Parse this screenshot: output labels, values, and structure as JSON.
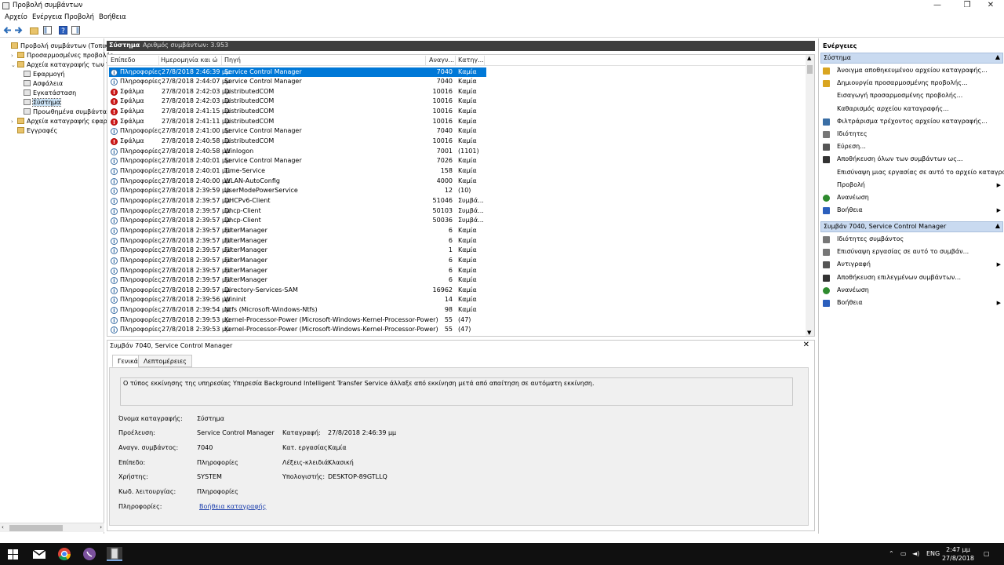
{
  "window": {
    "title": "Προβολή συμβάντων",
    "min": "—",
    "max": "❐",
    "close": "✕"
  },
  "menu": [
    "Αρχείο",
    "Ενέργεια",
    "Προβολή",
    "Βοήθεια"
  ],
  "tree": {
    "items": [
      {
        "label": "Προβολή συμβάντων (Τοπική)",
        "indent": 0,
        "expander": ""
      },
      {
        "label": "Προσαρμοσμένες προβολές",
        "indent": 1,
        "expander": "›"
      },
      {
        "label": "Αρχεία καταγραφής των Wi",
        "indent": 1,
        "expander": "⌄"
      },
      {
        "label": "Εφαρμογή",
        "indent": 2,
        "expander": ""
      },
      {
        "label": "Ασφάλεια",
        "indent": 2,
        "expander": ""
      },
      {
        "label": "Εγκατάσταση",
        "indent": 2,
        "expander": ""
      },
      {
        "label": "Σύστημα",
        "indent": 2,
        "expander": "",
        "selected": true
      },
      {
        "label": "Προωθημένα συμβάντα",
        "indent": 2,
        "expander": ""
      },
      {
        "label": "Αρχεία καταγραφής εφαρμ",
        "indent": 1,
        "expander": "›"
      },
      {
        "label": "Εγγραφές",
        "indent": 1,
        "expander": ""
      }
    ]
  },
  "center": {
    "log_name": "Σύστημα",
    "count_text": "Αριθμός συμβάντων: 3.953"
  },
  "grid": {
    "columns": [
      "Επίπεδο",
      "Ημερομηνία και ώ",
      "Πηγή",
      "Αναγν...",
      "Κατηγ..."
    ],
    "rows": [
      {
        "level": "Πληροφορίες",
        "type": "info",
        "date": "27/8/2018 2:46:39 μμ",
        "source": "Service Control Manager",
        "id": "7040",
        "cat": "Καμία",
        "selected": true
      },
      {
        "level": "Πληροφορίες",
        "type": "info",
        "date": "27/8/2018 2:44:07 μμ",
        "source": "Service Control Manager",
        "id": "7040",
        "cat": "Καμία"
      },
      {
        "level": "Σφάλμα",
        "type": "err",
        "date": "27/8/2018 2:42:03 μμ",
        "source": "DistributedCOM",
        "id": "10016",
        "cat": "Καμία"
      },
      {
        "level": "Σφάλμα",
        "type": "err",
        "date": "27/8/2018 2:42:03 μμ",
        "source": "DistributedCOM",
        "id": "10016",
        "cat": "Καμία"
      },
      {
        "level": "Σφάλμα",
        "type": "err",
        "date": "27/8/2018 2:41:15 μμ",
        "source": "DistributedCOM",
        "id": "10016",
        "cat": "Καμία"
      },
      {
        "level": "Σφάλμα",
        "type": "err",
        "date": "27/8/2018 2:41:11 μμ",
        "source": "DistributedCOM",
        "id": "10016",
        "cat": "Καμία"
      },
      {
        "level": "Πληροφορίες",
        "type": "info",
        "date": "27/8/2018 2:41:00 μμ",
        "source": "Service Control Manager",
        "id": "7040",
        "cat": "Καμία"
      },
      {
        "level": "Σφάλμα",
        "type": "err",
        "date": "27/8/2018 2:40:58 μμ",
        "source": "DistributedCOM",
        "id": "10016",
        "cat": "Καμία"
      },
      {
        "level": "Πληροφορίες",
        "type": "info",
        "date": "27/8/2018 2:40:58 μμ",
        "source": "Winlogon",
        "id": "7001",
        "cat": "(1101)"
      },
      {
        "level": "Πληροφορίες",
        "type": "info",
        "date": "27/8/2018 2:40:01 μμ",
        "source": "Service Control Manager",
        "id": "7026",
        "cat": "Καμία"
      },
      {
        "level": "Πληροφορίες",
        "type": "info",
        "date": "27/8/2018 2:40:01 μμ",
        "source": "Time-Service",
        "id": "158",
        "cat": "Καμία"
      },
      {
        "level": "Πληροφορίες",
        "type": "info",
        "date": "27/8/2018 2:40:00 μμ",
        "source": "WLAN-AutoConfig",
        "id": "4000",
        "cat": "Καμία"
      },
      {
        "level": "Πληροφορίες",
        "type": "info",
        "date": "27/8/2018 2:39:59 μμ",
        "source": "UserModePowerService",
        "id": "12",
        "cat": "(10)"
      },
      {
        "level": "Πληροφορίες",
        "type": "info",
        "date": "27/8/2018 2:39:57 μμ",
        "source": "DHCPv6-Client",
        "id": "51046",
        "cat": "Συμβά..."
      },
      {
        "level": "Πληροφορίες",
        "type": "info",
        "date": "27/8/2018 2:39:57 μμ",
        "source": "Dhcp-Client",
        "id": "50103",
        "cat": "Συμβά..."
      },
      {
        "level": "Πληροφορίες",
        "type": "info",
        "date": "27/8/2018 2:39:57 μμ",
        "source": "Dhcp-Client",
        "id": "50036",
        "cat": "Συμβά..."
      },
      {
        "level": "Πληροφορίες",
        "type": "info",
        "date": "27/8/2018 2:39:57 μμ",
        "source": "FilterManager",
        "id": "6",
        "cat": "Καμία"
      },
      {
        "level": "Πληροφορίες",
        "type": "info",
        "date": "27/8/2018 2:39:57 μμ",
        "source": "FilterManager",
        "id": "6",
        "cat": "Καμία"
      },
      {
        "level": "Πληροφορίες",
        "type": "info",
        "date": "27/8/2018 2:39:57 μμ",
        "source": "FilterManager",
        "id": "1",
        "cat": "Καμία"
      },
      {
        "level": "Πληροφορίες",
        "type": "info",
        "date": "27/8/2018 2:39:57 μμ",
        "source": "FilterManager",
        "id": "6",
        "cat": "Καμία"
      },
      {
        "level": "Πληροφορίες",
        "type": "info",
        "date": "27/8/2018 2:39:57 μμ",
        "source": "FilterManager",
        "id": "6",
        "cat": "Καμία"
      },
      {
        "level": "Πληροφορίες",
        "type": "info",
        "date": "27/8/2018 2:39:57 μμ",
        "source": "FilterManager",
        "id": "6",
        "cat": "Καμία"
      },
      {
        "level": "Πληροφορίες",
        "type": "info",
        "date": "27/8/2018 2:39:57 μμ",
        "source": "Directory-Services-SAM",
        "id": "16962",
        "cat": "Καμία"
      },
      {
        "level": "Πληροφορίες",
        "type": "info",
        "date": "27/8/2018 2:39:56 μμ",
        "source": "Wininit",
        "id": "14",
        "cat": "Καμία"
      },
      {
        "level": "Πληροφορίες",
        "type": "info",
        "date": "27/8/2018 2:39:54 μμ",
        "source": "Ntfs (Microsoft-Windows-Ntfs)",
        "id": "98",
        "cat": "Καμία"
      },
      {
        "level": "Πληροφορίες",
        "type": "info",
        "date": "27/8/2018 2:39:53 μμ",
        "source": "Kernel-Processor-Power (Microsoft-Windows-Kernel-Processor-Power)",
        "id": "55",
        "cat": "(47)"
      },
      {
        "level": "Πληροφορίες",
        "type": "info",
        "date": "27/8/2018 2:39:53 μμ",
        "source": "Kernel-Processor-Power (Microsoft-Windows-Kernel-Processor-Power)",
        "id": "55",
        "cat": "(47)"
      }
    ]
  },
  "details": {
    "title": "Συμβάν 7040, Service Control Manager",
    "close": "✕",
    "tab_general": "Γενικά",
    "tab_details": "Λεπτομέρειες",
    "message": "Ο τύπος εκκίνησης της υπηρεσίας Υπηρεσία Background Intelligent Transfer Service άλλαξε από εκκίνηση μετά από απαίτηση σε αυτόματη εκκίνηση.",
    "log_name_label": "Όνομα καταγραφής:",
    "log_name": "Σύστημα",
    "source_label": "Προέλευση:",
    "source": "Service Control Manager",
    "logged_label": "Καταγραφή:",
    "logged": "27/8/2018 2:46:39 μμ",
    "event_id_label": "Αναγν. συμβάντος:",
    "event_id": "7040",
    "task_label": "Κατ. εργασίας:",
    "task": "Καμία",
    "level_label": "Επίπεδο:",
    "level": "Πληροφορίες",
    "keywords_label": "Λέξεις-κλειδιά:",
    "keywords": "Κλασική",
    "user_label": "Χρήστης:",
    "user": "SYSTEM",
    "computer_label": "Υπολογιστής:",
    "computer": "DESKTOP-89GTLLQ",
    "opcode_label": "Κωδ. λειτουργίας:",
    "opcode": "Πληροφορίες",
    "info_label": "Πληροφορίες:",
    "info_link": "Βοήθεια καταγραφής"
  },
  "actions": {
    "title": "Ενέργειες",
    "section1": "Σύστημα",
    "section1_items": [
      {
        "label": "Άνοιγμα αποθηκευμένου αρχείου καταγραφής...",
        "icon": "open-log-icon",
        "color": "#d9a520"
      },
      {
        "label": "Δημιουργία προσαρμοσμένης προβολής...",
        "icon": "filter-create-icon",
        "color": "#d9a520"
      },
      {
        "label": "Εισαγωγή προσαρμοσμένης προβολής...",
        "icon": "",
        "color": ""
      },
      {
        "label": "Καθαρισμός αρχείου καταγραφής...",
        "icon": "",
        "color": ""
      },
      {
        "label": "Φιλτράρισμα τρέχοντος αρχείου καταγραφής...",
        "icon": "filter-icon",
        "color": "#3a6ea5"
      },
      {
        "label": "Ιδιότητες",
        "icon": "properties-icon",
        "color": "#777777"
      },
      {
        "label": "Εύρεση...",
        "icon": "find-icon",
        "color": "#555555"
      },
      {
        "label": "Αποθήκευση όλων των συμβάντων ως...",
        "icon": "save-icon",
        "color": "#333333"
      },
      {
        "label": "Επισύναψη μιας εργασίας σε αυτό το αρχείο καταγρα...",
        "icon": "",
        "color": ""
      },
      {
        "label": "Προβολή",
        "icon": "",
        "color": "",
        "submenu": true
      },
      {
        "label": "Ανανέωση",
        "icon": "refresh-icon",
        "color": "#2e8b2e"
      },
      {
        "label": "Βοήθεια",
        "icon": "help-icon",
        "color": "#2b5fbd",
        "submenu": true
      }
    ],
    "section2": "Συμβάν 7040, Service Control Manager",
    "section2_items": [
      {
        "label": "Ιδιότητες συμβάντος",
        "icon": "event-properties-icon",
        "color": "#777777"
      },
      {
        "label": "Επισύναψη εργασίας σε αυτό το συμβάν...",
        "icon": "attach-task-icon",
        "color": "#777777"
      },
      {
        "label": "Αντιγραφή",
        "icon": "copy-icon",
        "color": "#555555",
        "submenu": true
      },
      {
        "label": "Αποθήκευση επιλεγμένων συμβάντων...",
        "icon": "save-icon",
        "color": "#333333"
      },
      {
        "label": "Ανανέωση",
        "icon": "refresh-icon",
        "color": "#2e8b2e"
      },
      {
        "label": "Βοήθεια",
        "icon": "help-icon",
        "color": "#2b5fbd",
        "submenu": true
      }
    ]
  },
  "taskbar": {
    "lang": "ENG",
    "time": "2:47 μμ",
    "date": "27/8/2018"
  },
  "colors": {
    "selection": "#0078d7",
    "section_header": "#c9daf0",
    "taskbar": "#101010"
  }
}
